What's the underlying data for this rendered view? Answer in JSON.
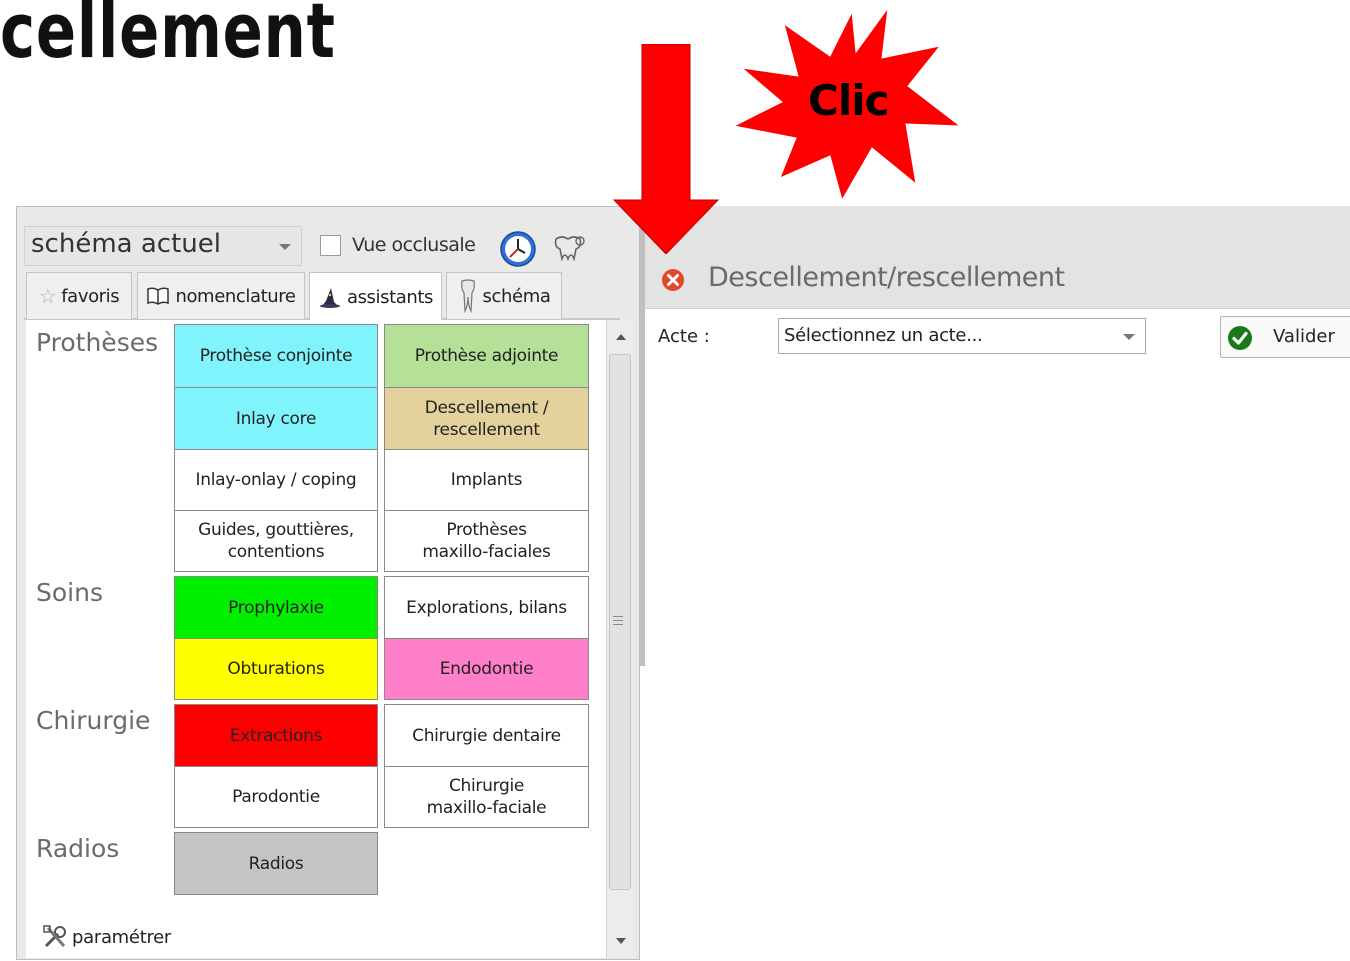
{
  "page_title": "cellement",
  "annotation": {
    "label": "Clic"
  },
  "left_panel": {
    "schema_select": {
      "value": "schéma actuel"
    },
    "vue_occlusale": {
      "label": "Vue occlusale",
      "checked": false
    },
    "tabs": [
      {
        "label": "favoris",
        "icon": "star-icon",
        "active": false
      },
      {
        "label": "nomenclature",
        "icon": "book-icon",
        "active": false
      },
      {
        "label": "assistants",
        "icon": "wizard-hat-icon",
        "active": true
      },
      {
        "label": "schéma",
        "icon": "tooth-icon",
        "active": false
      }
    ],
    "categories": {
      "protheses": "Prothèses",
      "soins": "Soins",
      "chirurgie": "Chirurgie",
      "radios": "Radios"
    },
    "buttons": {
      "prothese_conjointe": {
        "label": "Prothèse conjointe",
        "color": "#80f4fc"
      },
      "prothese_adjointe": {
        "label": "Prothèse adjointe",
        "color": "#b4e098"
      },
      "inlay_core": {
        "label": "Inlay core",
        "color": "#80f4fc"
      },
      "descellement_line1": {
        "label": "Descellement /",
        "color": "#e4d29c"
      },
      "descellement_line2": {
        "label": "rescellement"
      },
      "inlay_onlay": {
        "label": "Inlay-onlay / coping"
      },
      "implants": {
        "label": "Implants"
      },
      "guides_line1": {
        "label": "Guides, gouttières,"
      },
      "guides_line2": {
        "label": "contentions"
      },
      "maxillo_prot_line1": {
        "label": "Prothèses"
      },
      "maxillo_prot_line2": {
        "label": "maxillo-faciales"
      },
      "prophylaxie": {
        "label": "Prophylaxie",
        "color": "#00f000"
      },
      "explorations": {
        "label": "Explorations, bilans"
      },
      "obturations": {
        "label": "Obturations",
        "color": "#ffff00"
      },
      "endodontie": {
        "label": "Endodontie",
        "color": "#ff80c8"
      },
      "extractions": {
        "label": "Extractions",
        "color": "#ff0000"
      },
      "chirurgie_dentaire": {
        "label": "Chirurgie dentaire"
      },
      "parodontie": {
        "label": "Parodontie"
      },
      "chirurgie_mf_line1": {
        "label": "Chirurgie"
      },
      "chirurgie_mf_line2": {
        "label": "maxillo-faciale"
      },
      "radios": {
        "label": "Radios",
        "color": "#c4c4c4"
      }
    },
    "parametrer": "paramétrer"
  },
  "right_panel": {
    "title": "Descellement/rescellement",
    "acte_label": "Acte :",
    "acte_select": {
      "value": "Sélectionnez un acte..."
    },
    "valider": "Valider"
  }
}
